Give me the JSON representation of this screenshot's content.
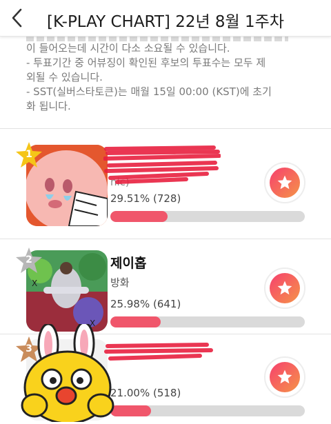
{
  "header": {
    "title": "[K-PLAY CHART] 22년 8월 1주차",
    "back_icon": "chevron-left-icon"
  },
  "notice": {
    "lines": [
      "이 들어오는데 시간이 다소 소요될 수 있습니다.",
      "- 투표기간 중 어뷰징이 확인된 후보의 투표수는 모두 제",
      "외될 수 있습니다.",
      "- SST(실버스타토큰)는 매월 15일 00:00 (KST)에 초기",
      "화 됩니다."
    ]
  },
  "items": [
    {
      "rank": "1",
      "name": "",
      "song": "",
      "song_suffix": "nic)",
      "percent_text": "29.51% (728)",
      "percent": 29.51,
      "votes": 728,
      "badge_color": "#f5c518"
    },
    {
      "rank": "2",
      "name": "제이홉",
      "song": "방화",
      "percent_text": "25.98% (641)",
      "percent": 25.98,
      "votes": 641,
      "badge_color": "#b7b7b7"
    },
    {
      "rank": "3",
      "name": "",
      "song": "",
      "percent_text": "21.00% (518)",
      "percent": 21.0,
      "votes": 518,
      "badge_color": "#c98c5b"
    }
  ],
  "colors": {
    "progress_fill": "#f0566b",
    "progress_track": "#dadada",
    "vote_gradient_start": "#f6406e",
    "vote_gradient_end": "#f59448"
  }
}
